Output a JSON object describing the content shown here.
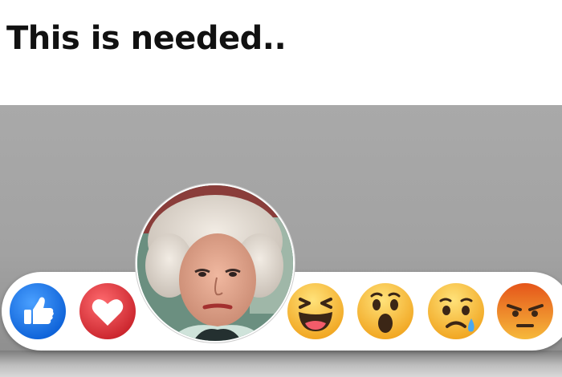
{
  "caption": "This is needed..",
  "reactions": [
    {
      "name": "like",
      "icon": "thumbs-up-icon",
      "color": "#1877f2"
    },
    {
      "name": "love",
      "icon": "heart-icon",
      "color": "#e0383e"
    },
    {
      "name": "custom",
      "icon": "portrait-photo"
    },
    {
      "name": "haha",
      "icon": "laughing-face-icon",
      "color": "#f7b125"
    },
    {
      "name": "wow",
      "icon": "surprised-face-icon",
      "color": "#f7b125"
    },
    {
      "name": "sad",
      "icon": "crying-face-icon",
      "color": "#f7b125"
    },
    {
      "name": "angry",
      "icon": "angry-face-icon",
      "color": "#e9710f"
    }
  ]
}
